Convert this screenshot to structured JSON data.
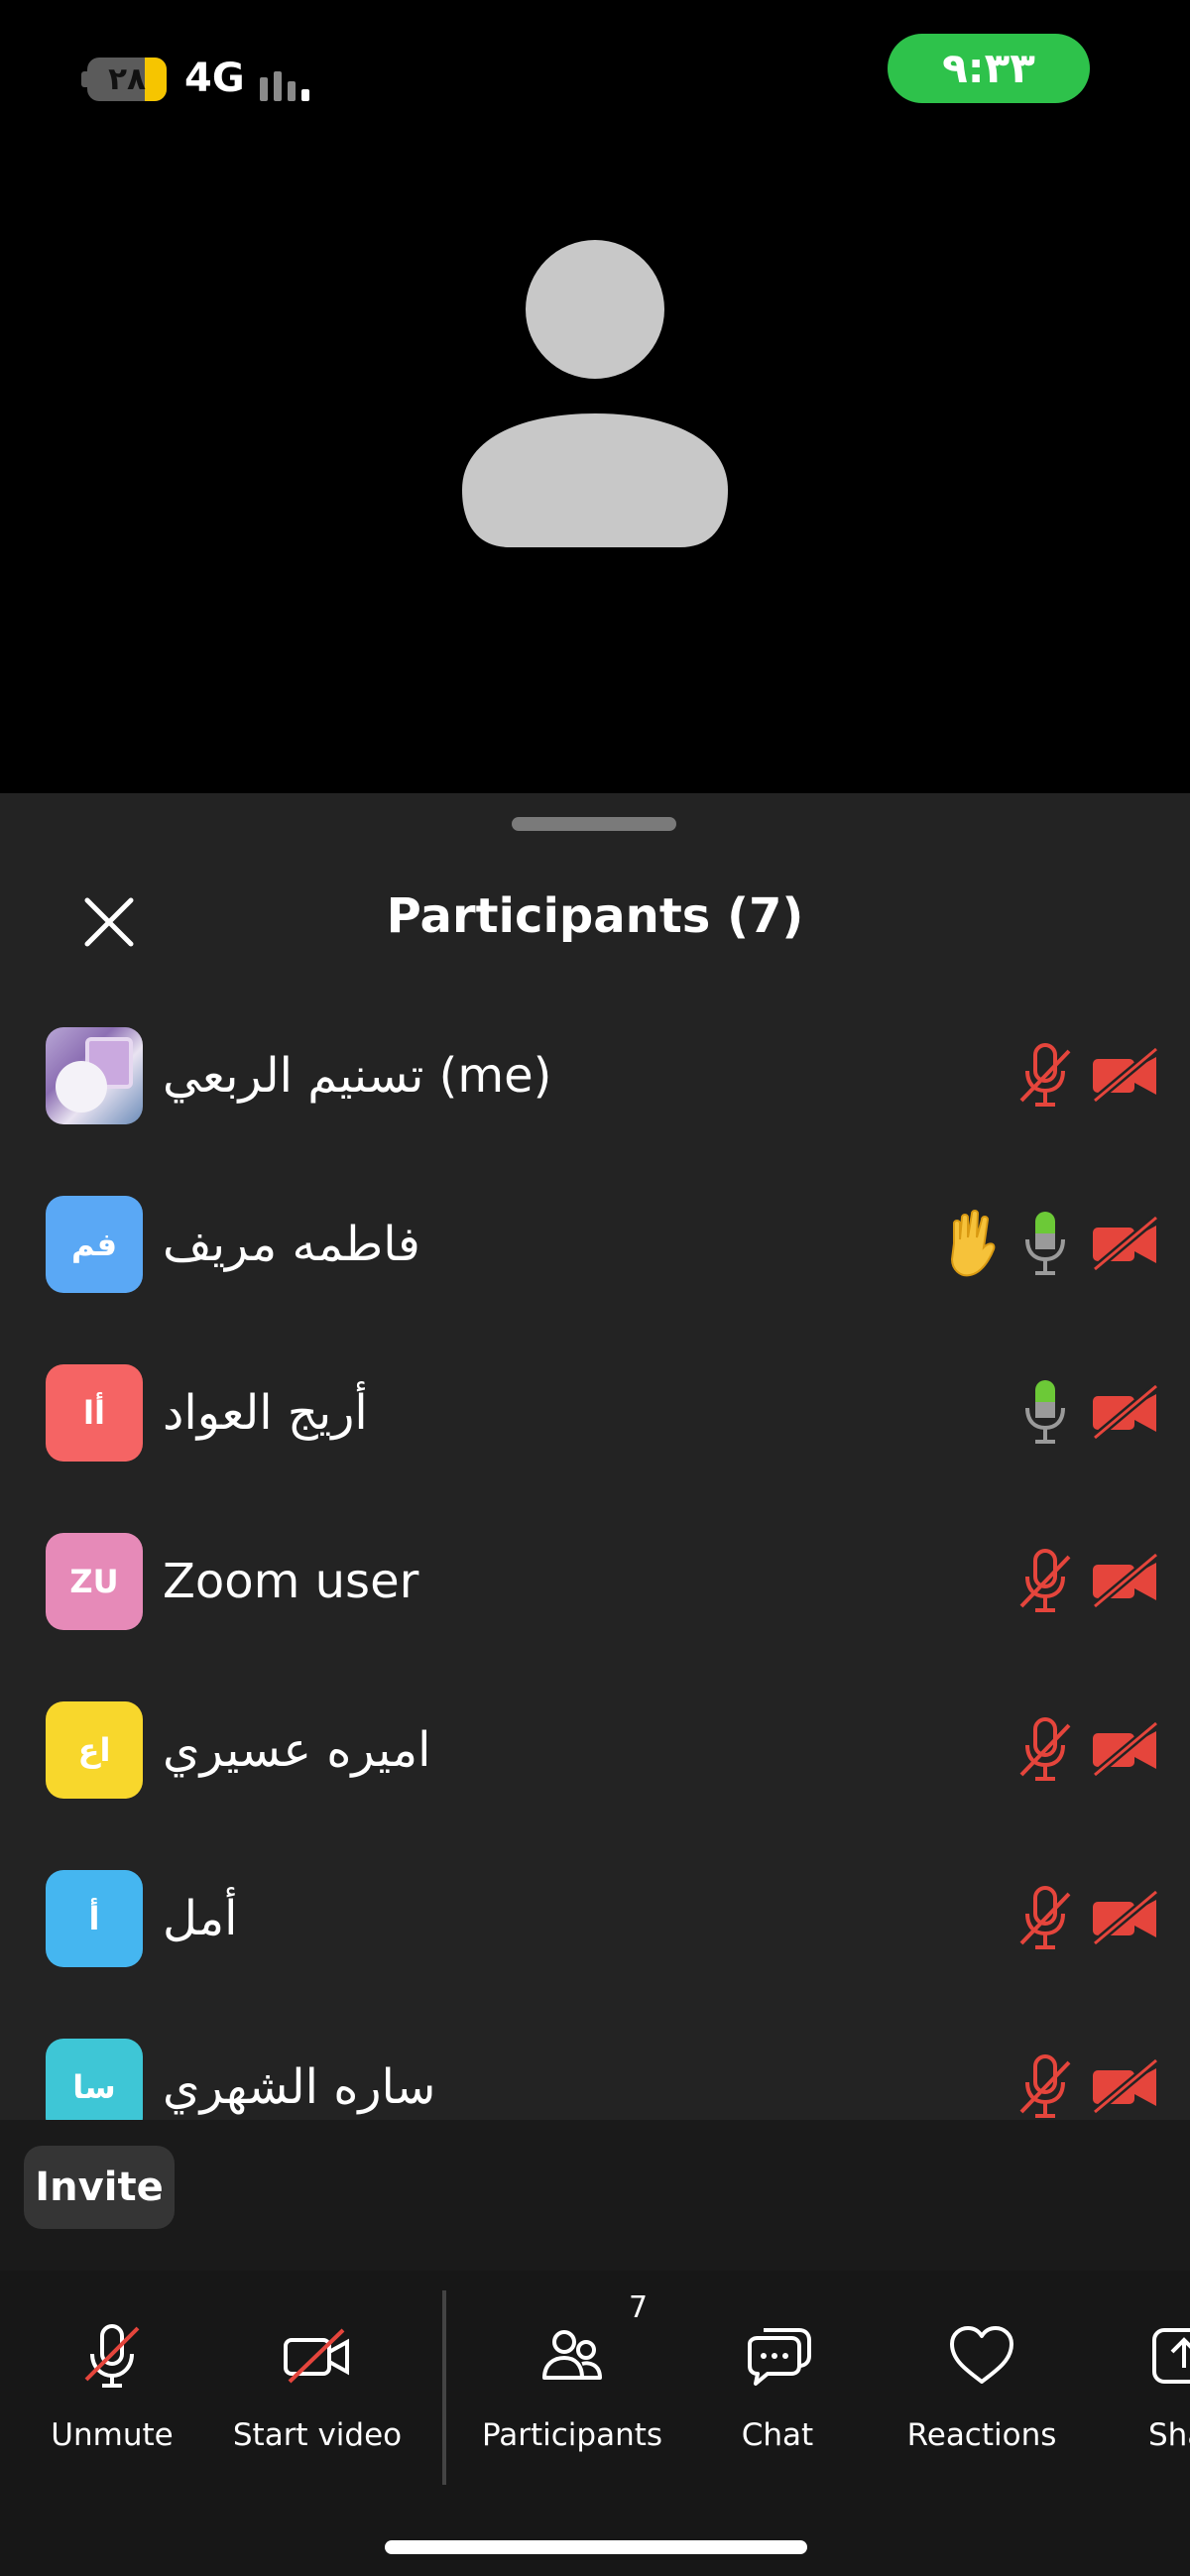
{
  "status_bar": {
    "battery_level": "٢٨",
    "battery_fill_fraction": 0.28,
    "network": "4G",
    "time": "٩:٣٣",
    "colors": {
      "clock_pill": "#2ec24b",
      "battery_fill": "#f6c500"
    }
  },
  "sheet": {
    "title": "Participants (7)",
    "close_icon": "close-icon"
  },
  "participants": [
    {
      "name": "تسنيم الربعي (me)",
      "avatar_type": "photo",
      "initials": "",
      "avatar_color": "",
      "hand_raised": false,
      "mic": "muted",
      "camera": "off"
    },
    {
      "name": "فاطمه مريف",
      "avatar_type": "initials",
      "initials": "فم",
      "avatar_color": "#5aa8f5",
      "hand_raised": true,
      "mic": "on",
      "camera": "off"
    },
    {
      "name": "أريج العواد",
      "avatar_type": "initials",
      "initials": "أا",
      "avatar_color": "#f56464",
      "hand_raised": false,
      "mic": "on",
      "camera": "off"
    },
    {
      "name": "Zoom user",
      "avatar_type": "initials",
      "initials": "ZU",
      "avatar_color": "#e68ab8",
      "hand_raised": false,
      "mic": "muted",
      "camera": "off"
    },
    {
      "name": "اميره عسيري",
      "avatar_type": "initials",
      "initials": "اع",
      "avatar_color": "#f8d72c",
      "hand_raised": false,
      "mic": "muted",
      "camera": "off"
    },
    {
      "name": "أمل",
      "avatar_type": "initials",
      "initials": "أ",
      "avatar_color": "#45b6f0",
      "hand_raised": false,
      "mic": "muted",
      "camera": "off"
    },
    {
      "name": "ساره الشهري",
      "avatar_type": "initials",
      "initials": "سا",
      "avatar_color": "#3ec6d6",
      "hand_raised": false,
      "mic": "muted",
      "camera": "off"
    }
  ],
  "invite": {
    "label": "Invite"
  },
  "toolbar": {
    "unmute": "Unmute",
    "start_video": "Start video",
    "participants": "Participants",
    "participants_badge": "7",
    "chat": "Chat",
    "reactions": "Reactions",
    "share": "Sha"
  },
  "colors": {
    "muted_red": "#e5453c",
    "mic_on_green": "#6cc937",
    "sheet_bg": "#232323"
  }
}
